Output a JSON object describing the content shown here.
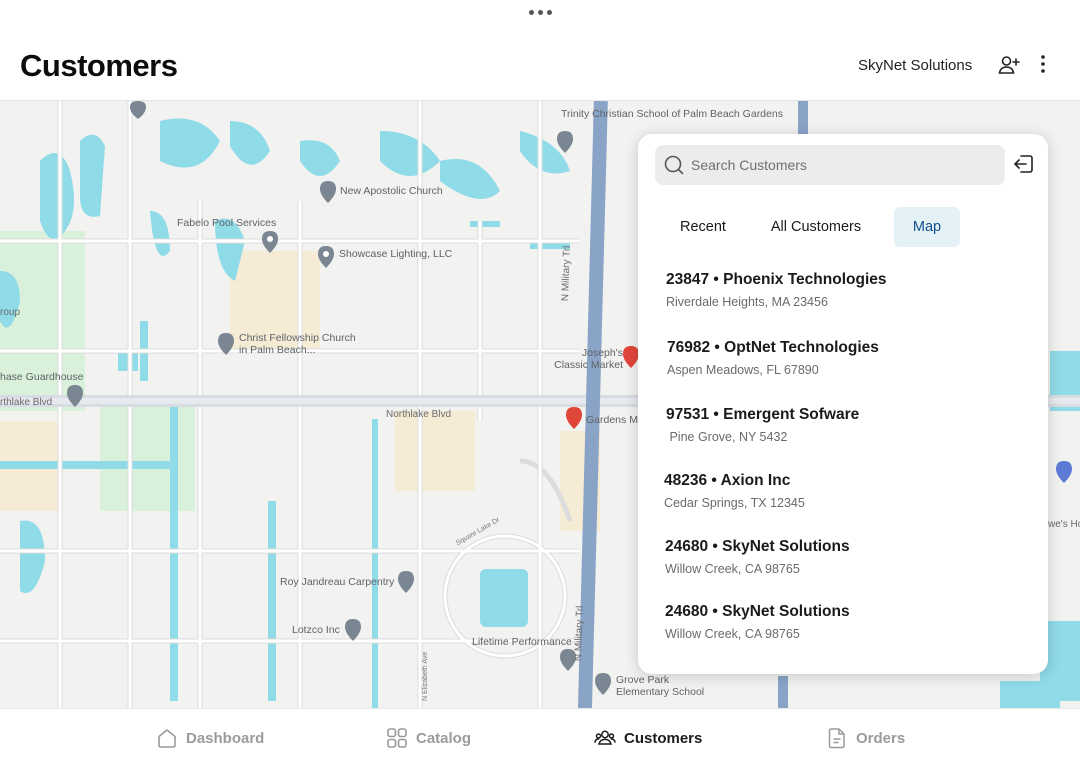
{
  "header": {
    "title": "Customers",
    "company": "SkyNet Solutions",
    "add_user_icon": "add-user-icon",
    "menu_icon": "kebab-menu-icon"
  },
  "map": {
    "labels": {
      "school": "Trinity Christian School of Palm Beach Gardens",
      "church": "New Apostolic Church",
      "pool": "Fabelo Pool Services",
      "lighting": "Showcase Lighting, LLC",
      "fellowship": "Christ Fellowship Church in Palm Beach...",
      "market": "Joseph's Classic Market",
      "guardhouse": "hase Guardhouse",
      "northlake_left": "rthlake Blvd",
      "northlake": "Northlake Blvd",
      "gardens": "Gardens Ma",
      "carpentry": "Roy Jandreau Carpentry",
      "lotzco": "Lotzco Inc",
      "lifetime": "Lifetime Performance",
      "grove": "Grove Park Elementary School",
      "military": "N Military Trl",
      "military2": "N Military Trl",
      "elizabeth": "N Elizabeth Ave",
      "square_lake": "Square Lake Dr",
      "roup": "roup",
      "lowes": "we's Ho"
    }
  },
  "panel": {
    "search_placeholder": "Search Customers",
    "tabs": [
      {
        "label": "Recent"
      },
      {
        "label": "All Customers"
      },
      {
        "label": "Map"
      }
    ],
    "active_tab": "Map",
    "customers": [
      {
        "name": "23847 • Phoenix Technologies",
        "address": "Riverdale Heights, MA 23456"
      },
      {
        "name": "76982 • OptNet Technologies",
        "address": "Aspen Meadows, FL 67890"
      },
      {
        "name": "97531 • Emergent Sofware",
        "address": " Pine Grove, NY 5432"
      },
      {
        "name": "48236 • Axion Inc",
        "address": "Cedar Springs, TX 12345"
      },
      {
        "name": "24680 • SkyNet Solutions",
        "address": "Willow Creek, CA 98765"
      },
      {
        "name": "24680 • SkyNet Solutions",
        "address": "Willow Creek, CA 98765"
      }
    ]
  },
  "nav": {
    "items": [
      {
        "label": "Dashboard",
        "icon": "home-icon"
      },
      {
        "label": "Catalog",
        "icon": "grid-icon"
      },
      {
        "label": "Customers",
        "icon": "users-icon"
      },
      {
        "label": "Orders",
        "icon": "document-icon"
      }
    ],
    "active": "Customers"
  },
  "colors": {
    "water": "#8fdbe8",
    "road": "#ffffff",
    "highway": "#8aa4c8",
    "park": "#d6f0d9",
    "sand": "#f7ecd6",
    "active_tab_bg": "#e4f2f8",
    "active_tab_text": "#134e8c"
  }
}
